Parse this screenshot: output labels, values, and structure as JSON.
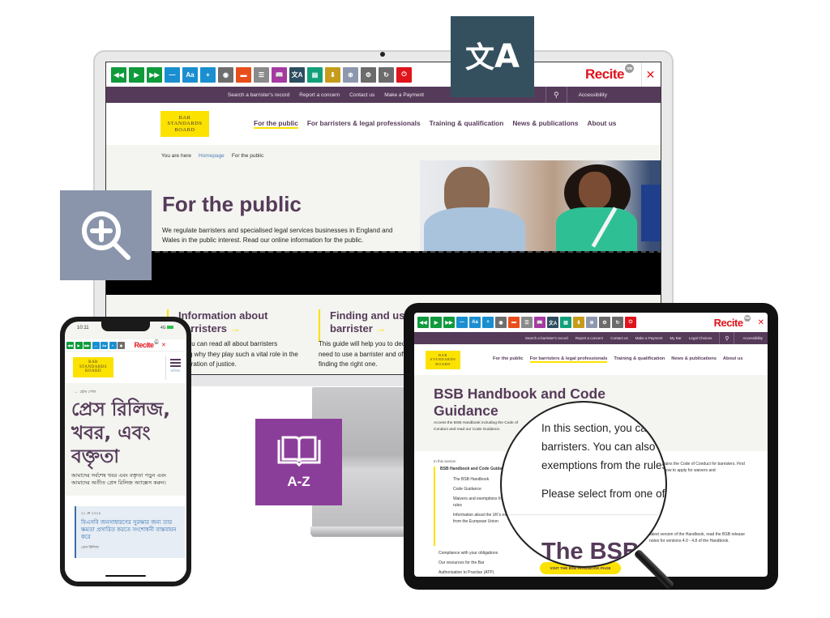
{
  "recite_toolbar": {
    "buttons": [
      {
        "name": "rewind-icon",
        "glyph": "◀◀",
        "color": "#0f9a3c"
      },
      {
        "name": "play-icon",
        "glyph": "▶",
        "color": "#0f9a3c"
      },
      {
        "name": "fast-forward-icon",
        "glyph": "▶▶",
        "color": "#0f9a3c"
      },
      {
        "name": "decrease-text-icon",
        "glyph": "—",
        "color": "#1a8fd0"
      },
      {
        "name": "font-icon",
        "glyph": "Aa",
        "color": "#1a8fd0"
      },
      {
        "name": "increase-text-icon",
        "glyph": "+",
        "color": "#1a8fd0"
      },
      {
        "name": "color-wheel-icon",
        "glyph": "◉",
        "color": "#6e6e6e"
      },
      {
        "name": "ruler-icon",
        "glyph": "▬",
        "color": "#e84e1b"
      },
      {
        "name": "screen-mask-icon",
        "glyph": "☰",
        "color": "#8a8a8a"
      },
      {
        "name": "dictionary-icon",
        "glyph": "📖",
        "color": "#a53aa3"
      },
      {
        "name": "translate-icon",
        "glyph": "文A",
        "color": "#2d4d60"
      },
      {
        "name": "text-mode-icon",
        "glyph": "▤",
        "color": "#12a07a"
      },
      {
        "name": "download-icon",
        "glyph": "⬇",
        "color": "#c79c1c"
      },
      {
        "name": "magnifier-icon",
        "glyph": "⊕",
        "color": "#8d98ae"
      },
      {
        "name": "settings-icon",
        "glyph": "⚙",
        "color": "#6b6b6b"
      },
      {
        "name": "reset-icon",
        "glyph": "↻",
        "color": "#6b6b6b"
      },
      {
        "name": "exit-icon",
        "glyph": "⏻",
        "color": "#e1131b"
      }
    ],
    "logo": "Recite",
    "logo_badge": "me",
    "close": "✕"
  },
  "desktop": {
    "topbar_links": [
      "Search a barrister's record",
      "Report a concern",
      "Contact us",
      "Make a Payment"
    ],
    "search_icon": "⚲",
    "accessibility": "Accessibility",
    "logo_lines": [
      "BAR",
      "STANDARDS",
      "BOARD"
    ],
    "nav": [
      "For the public",
      "For barristers & legal professionals",
      "Training & qualification",
      "News & publications",
      "About us"
    ],
    "breadcrumb": {
      "label": "You are here",
      "home": "Homepage",
      "current": "For the public"
    },
    "title": "For the public",
    "intro": "We regulate barristers and specialised legal services businesses in England and Wales in the public interest. Read our online information for the public.",
    "cards": [
      {
        "title_1": "Information about",
        "title_2": "barristers",
        "arrow": "→",
        "body": "Here, you can read all about barristers including why they play such a vital role in the administration of justice."
      },
      {
        "title_1": "Finding and using a",
        "title_2": "barrister",
        "arrow": "→",
        "body": "This guide will help you to decide whether you need to use a barrister and offer advice on finding the right one."
      }
    ]
  },
  "overlays": {
    "translate_tile": {
      "glyph_1": "文",
      "glyph_2": "A",
      "color": "#34505f"
    },
    "zoom_tile": {
      "color": "#8a95ab"
    },
    "az_tile": {
      "label": "A-Z",
      "color": "#8b3e99"
    }
  },
  "phone": {
    "time": "10:11",
    "status": "4G",
    "menu_label": "তালিকা",
    "back": "← হোম পেজ",
    "title": "প্রেস রিলিজ, খবর, এবং বক্তৃতা",
    "intro": "আমাদের সর্বশেষ খবর এবং বক্তৃতা পড়ুন এবং আমাদের অতীত প্রেস রিলিজ অ্যাক্সেস করুন।",
    "card": {
      "date": "২১ মে ২০২৪",
      "title": "বিএসবি জনসাধারণের সুরক্ষার জন্য তার ক্ষমতা প্রসারিত করতে সংশোধনী বাস্তবায়ন করে",
      "tag": "প্রেস রিলিজ"
    }
  },
  "tablet": {
    "topbar_links": [
      "Search a barrister's record",
      "Report a concern",
      "Contact us",
      "Make a Payment",
      "My Bar",
      "Legal Choices"
    ],
    "accessibility": "Accessibility",
    "nav": [
      "For the public",
      "For barristers & legal professionals",
      "Training & qualification",
      "News & publications",
      "About us"
    ],
    "title": "BSB Handbook and Code Guidance",
    "intro": "Access the BSB Handbook including the Code of Conduct and read our Code Guidance.",
    "in_this_section": "In this section",
    "sidebar": {
      "heading": "BSB Handbook and Code Guidance",
      "items": [
        "The BSB Handbook",
        "Code Guidance",
        "Waivers and exemptions from the rules",
        "Information about the UK's exit from the European Union"
      ],
      "other": [
        "Compliance with your obligations",
        "Our resources for the Bar",
        "Authorisation to Practise (ATP)"
      ]
    },
    "body_right_1": "contains the Code of Conduct for barristers. Find out how to apply for waivers and",
    "body_right_2": "latest version of the Handbook, read the BSB release notes for versions 4.0 - 4.8 of the Handbook.",
    "cta": "VISIT THE BSB HANDBOOK PAGE",
    "lens": {
      "lines": [
        "In this section, you can",
        "barristers. You can also",
        "exemptions from the rules."
      ],
      "line_4": "Please select from one of",
      "heading": "The BSB"
    }
  }
}
